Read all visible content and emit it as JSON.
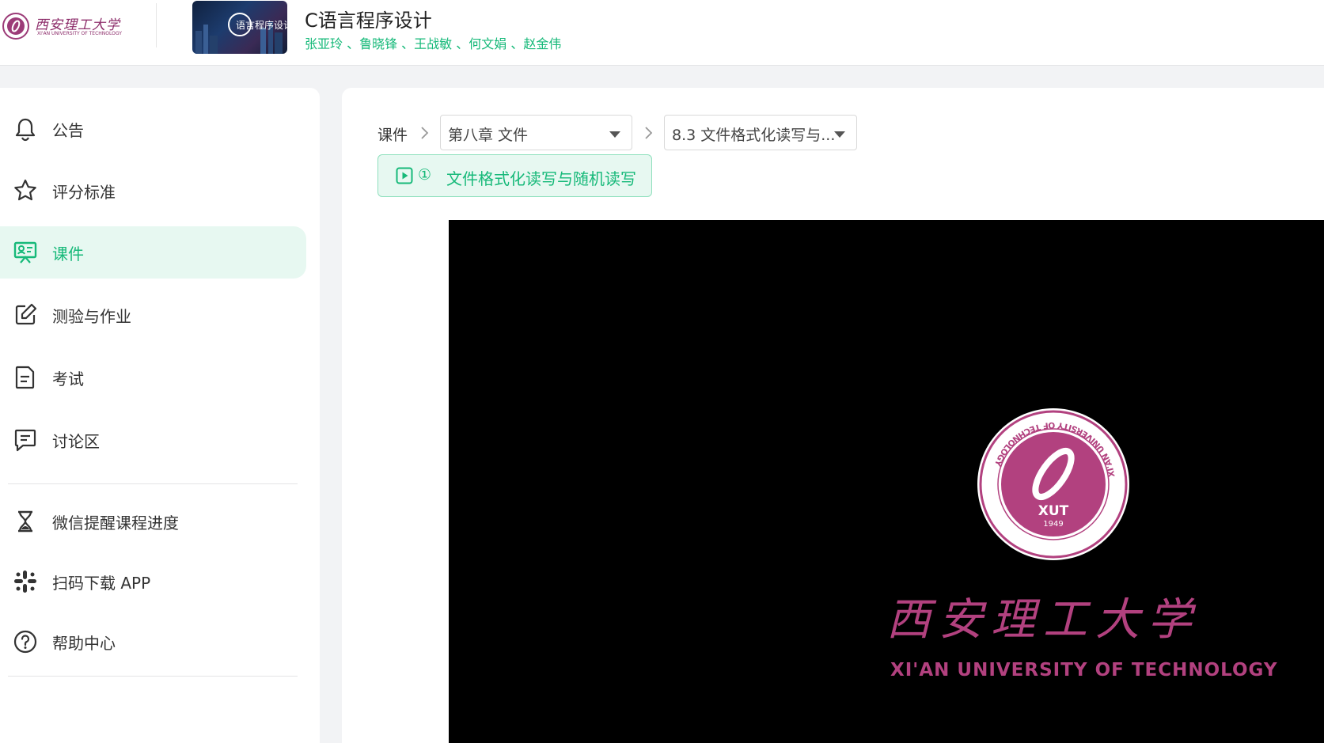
{
  "header": {
    "logo_brand": "西安理工大学",
    "logo_subtitle": "XI'AN UNIVERSITY OF TECHNOLOGY",
    "cover_text": "语言程序设计",
    "course_title": "C语言程序设计",
    "teachers": "张亚玲 、鲁晓锋 、王战敏 、何文娟 、赵金伟"
  },
  "sidebar": {
    "items": [
      {
        "label": "公告",
        "icon": "bell-icon"
      },
      {
        "label": "评分标准",
        "icon": "star-icon"
      },
      {
        "label": "课件",
        "icon": "presentation-icon",
        "active": true
      },
      {
        "label": "测验与作业",
        "icon": "edit-icon"
      },
      {
        "label": "考试",
        "icon": "document-icon"
      },
      {
        "label": "讨论区",
        "icon": "chat-icon"
      }
    ],
    "extra": [
      {
        "label": "微信提醒课程进度",
        "icon": "hourglass-icon"
      },
      {
        "label": "扫码下载 APP",
        "icon": "apps-icon"
      },
      {
        "label": "帮助中心",
        "icon": "help-icon"
      }
    ]
  },
  "main": {
    "breadcrumb_root": "课件",
    "chapter_select": "第八章 文件",
    "section_select": "8.3 文件格式化读写与...",
    "lesson": {
      "number": "①",
      "title": "文件格式化读写与随机读写"
    }
  },
  "video": {
    "seal_abbr": "XUT",
    "seal_year": "1949",
    "seal_ring_text": "XI'AN UNIVERSITY OF TECHNOLOGY",
    "name_cn": "西安理工大学",
    "name_en": "XI'AN UNIVERSITY OF TECHNOLOGY"
  },
  "colors": {
    "accent": "#16b979",
    "active_bg": "#e7f8f1",
    "brand_magenta": "#b2417f"
  }
}
